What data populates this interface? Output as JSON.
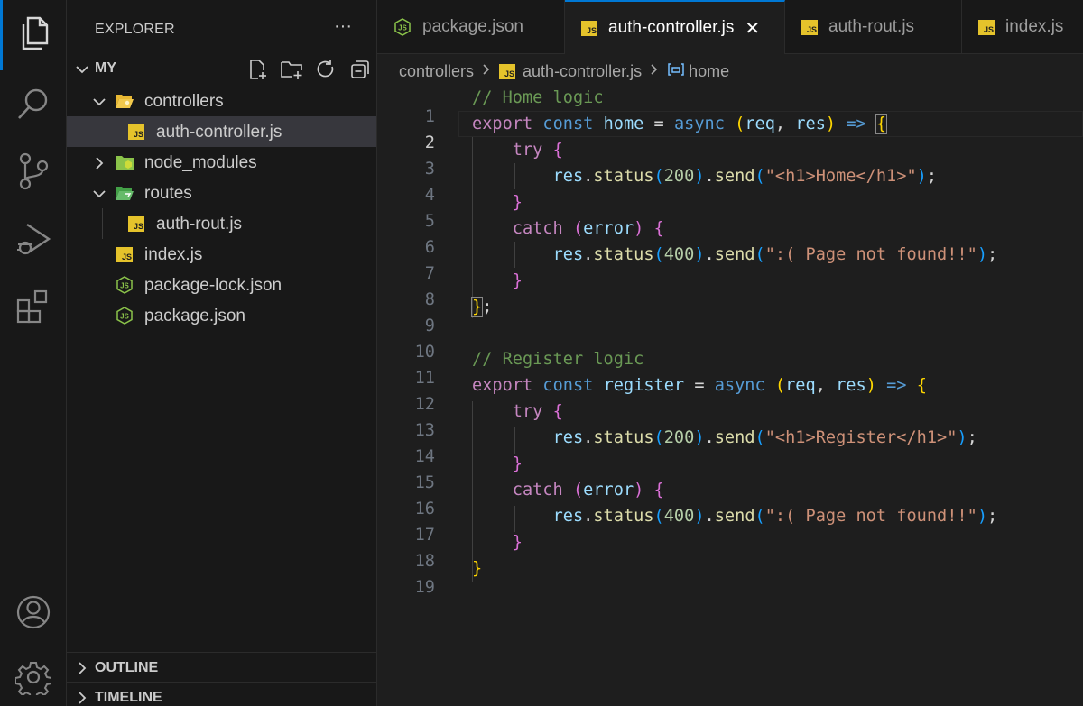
{
  "explorer": {
    "title": "EXPLORER",
    "more": "···",
    "root": "MY",
    "items": [
      {
        "label": "controllers"
      },
      {
        "label": "auth-controller.js"
      },
      {
        "label": "node_modules"
      },
      {
        "label": "routes"
      },
      {
        "label": "auth-rout.js"
      },
      {
        "label": "index.js"
      },
      {
        "label": "package-lock.json"
      },
      {
        "label": "package.json"
      }
    ],
    "panels": [
      "OUTLINE",
      "TIMELINE"
    ]
  },
  "tabs": [
    {
      "label": "package.json",
      "icon": "json-icon"
    },
    {
      "label": "auth-controller.js",
      "icon": "js-icon",
      "active": true
    },
    {
      "label": "auth-rout.js",
      "icon": "js-icon"
    },
    {
      "label": "index.js",
      "icon": "js-icon"
    }
  ],
  "breadcrumb": {
    "folder": "controllers",
    "file": "auth-controller.js",
    "symbol": "home"
  },
  "editor": {
    "current_line": 2,
    "line_numbers": [
      "1",
      "2",
      "3",
      "4",
      "5",
      "6",
      "7",
      "8",
      "9",
      "10",
      "11",
      "12",
      "13",
      "14",
      "15",
      "16",
      "17",
      "18",
      "19"
    ],
    "code": {
      "l1": "// Home logic",
      "l2_export": "export",
      "l2_const": "const",
      "l2_name": "home",
      "l2_async": "async",
      "l2_req": "req",
      "l2_res": "res",
      "try": "try",
      "catch": "catch",
      "error": "error",
      "res": "res",
      "status": "status",
      "send": "send",
      "n200": "200",
      "n400": "400",
      "home_str": "\"<h1>Home</h1>\"",
      "notfound_str": "\":( Page not found!!\"",
      "l11": "// Register logic",
      "l12_name": "register",
      "register_str": "\"<h1>Register</h1>\""
    }
  },
  "colors": {
    "accent": "#0078d4",
    "js_badge": "#e5c32b",
    "json_icon": "#8bc34a",
    "folder": "#e8b833",
    "node_folder": "#8bc34a",
    "routes_folder": "#4caf50"
  }
}
